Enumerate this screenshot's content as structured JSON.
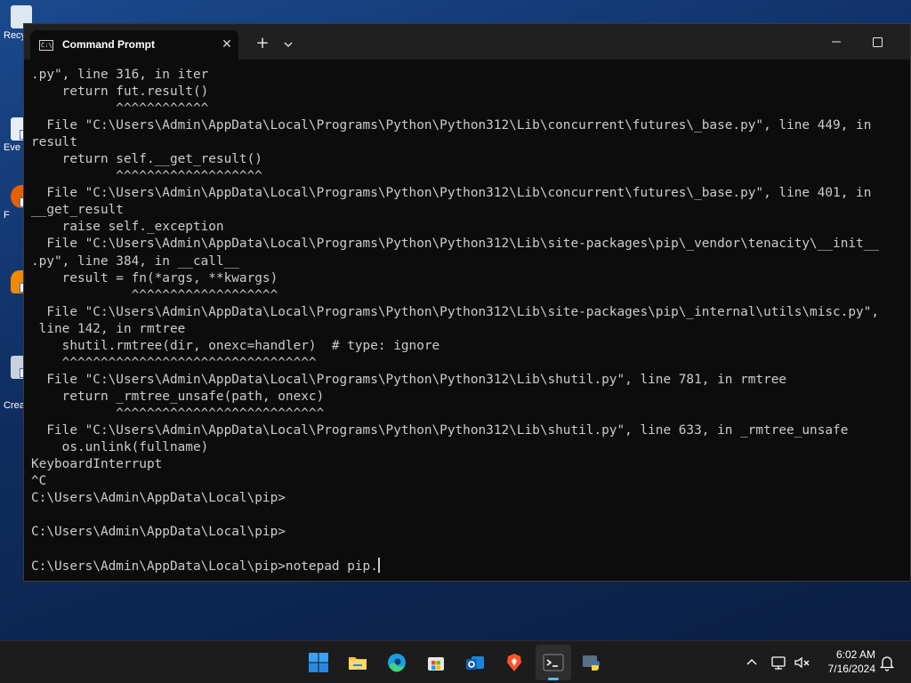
{
  "desktop": {
    "icons": [
      {
        "name": "recycle-bin",
        "label": "Recy"
      },
      {
        "name": "everything",
        "label": "Eve"
      },
      {
        "name": "firefox",
        "label": "F"
      },
      {
        "name": "vlc",
        "label": ""
      },
      {
        "name": "create",
        "label": "Crea"
      }
    ]
  },
  "window": {
    "tab_title": "Command Prompt",
    "tab_icon_text": "C:\\",
    "close_glyph": "✕",
    "new_tab_glyph": "+"
  },
  "console": {
    "lines": [
      ".py\", line 316, in iter",
      "    return fut.result()",
      "           ^^^^^^^^^^^^",
      "  File \"C:\\Users\\Admin\\AppData\\Local\\Programs\\Python\\Python312\\Lib\\concurrent\\futures\\_base.py\", line 449, in",
      "result",
      "    return self.__get_result()",
      "           ^^^^^^^^^^^^^^^^^^^",
      "  File \"C:\\Users\\Admin\\AppData\\Local\\Programs\\Python\\Python312\\Lib\\concurrent\\futures\\_base.py\", line 401, in",
      "__get_result",
      "    raise self._exception",
      "  File \"C:\\Users\\Admin\\AppData\\Local\\Programs\\Python\\Python312\\Lib\\site-packages\\pip\\_vendor\\tenacity\\__init__",
      ".py\", line 384, in __call__",
      "    result = fn(*args, **kwargs)",
      "             ^^^^^^^^^^^^^^^^^^^",
      "  File \"C:\\Users\\Admin\\AppData\\Local\\Programs\\Python\\Python312\\Lib\\site-packages\\pip\\_internal\\utils\\misc.py\",",
      " line 142, in rmtree",
      "    shutil.rmtree(dir, onexc=handler)  # type: ignore",
      "    ^^^^^^^^^^^^^^^^^^^^^^^^^^^^^^^^^",
      "  File \"C:\\Users\\Admin\\AppData\\Local\\Programs\\Python\\Python312\\Lib\\shutil.py\", line 781, in rmtree",
      "    return _rmtree_unsafe(path, onexc)",
      "           ^^^^^^^^^^^^^^^^^^^^^^^^^^^",
      "  File \"C:\\Users\\Admin\\AppData\\Local\\Programs\\Python\\Python312\\Lib\\shutil.py\", line 633, in _rmtree_unsafe",
      "    os.unlink(fullname)",
      "KeyboardInterrupt",
      "^C",
      "C:\\Users\\Admin\\AppData\\Local\\pip>",
      "",
      "C:\\Users\\Admin\\AppData\\Local\\pip>",
      "",
      "C:\\Users\\Admin\\AppData\\Local\\pip>notepad pip."
    ]
  },
  "taskbar": {
    "apps": [
      {
        "name": "start-button",
        "icon": "windows-logo-icon"
      },
      {
        "name": "file-explorer-button",
        "icon": "folder-icon"
      },
      {
        "name": "edge-button",
        "icon": "edge-icon"
      },
      {
        "name": "store-button",
        "icon": "store-icon"
      },
      {
        "name": "outlook-button",
        "icon": "outlook-icon"
      },
      {
        "name": "brave-button",
        "icon": "brave-icon"
      },
      {
        "name": "terminal-button",
        "icon": "terminal-icon"
      },
      {
        "name": "python-button",
        "icon": "python-icon"
      }
    ],
    "active_app": "terminal-button",
    "clock": {
      "time": "6:02 AM",
      "date": "7/16/2024"
    }
  },
  "colors": {
    "console_bg": "#0c0c0c",
    "console_fg": "#cccccc",
    "titlebar": "#202020",
    "taskbar": "#1c1c1c",
    "accent": "#4cc2ff"
  }
}
